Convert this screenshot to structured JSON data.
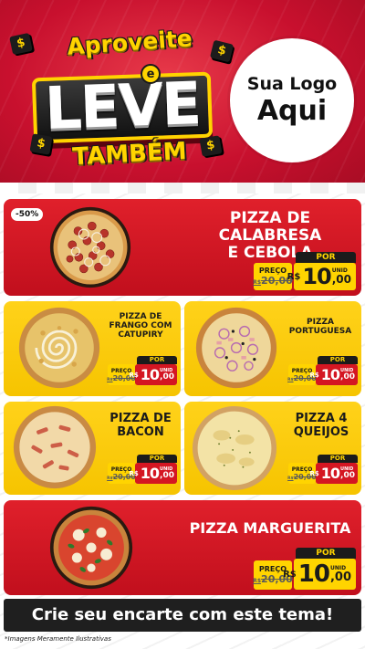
{
  "header": {
    "promo_line1": "Aproveite",
    "promo_connector": "e",
    "promo_line2": "LEVE",
    "promo_line3": "TAMBÉM",
    "logo_line1": "Sua Logo",
    "logo_line2": "Aqui"
  },
  "featured": {
    "discount": "-50%",
    "name_line1": "PIZZA DE CALABRESA",
    "name_line2": "E CEBOLA",
    "por_label": "POR",
    "preco_label": "PREÇO",
    "old_price_prefix": "R$",
    "old_price": "20,00",
    "currency": "R$",
    "price_int": "10",
    "price_dec": ",00",
    "unit": "UNID"
  },
  "grid": [
    {
      "name_lines": [
        "PIZZA DE",
        "FRANGO COM",
        "CATUPIRY"
      ],
      "por_label": "POR",
      "preco_label": "PREÇO",
      "old_price_prefix": "R$",
      "old_price": "20,00",
      "currency": "R$",
      "price_int": "10",
      "price_dec": ",00",
      "unit": "UNID"
    },
    {
      "name_lines": [
        "PIZZA",
        "PORTUGUESA"
      ],
      "por_label": "POR",
      "preco_label": "PREÇO",
      "old_price_prefix": "R$",
      "old_price": "20,00",
      "currency": "R$",
      "price_int": "10",
      "price_dec": ",00",
      "unit": "UNID"
    },
    {
      "name_lines": [
        "PIZZA DE",
        "BACON"
      ],
      "por_label": "POR",
      "preco_label": "PREÇO",
      "old_price_prefix": "R$",
      "old_price": "20,00",
      "currency": "R$",
      "price_int": "10",
      "price_dec": ",00",
      "unit": "UNID"
    },
    {
      "name_lines": [
        "PIZZA 4",
        "QUEIJOS"
      ],
      "por_label": "POR",
      "preco_label": "PREÇO",
      "old_price_prefix": "R$",
      "old_price": "20,00",
      "currency": "R$",
      "price_int": "10",
      "price_dec": ",00",
      "unit": "UNID"
    }
  ],
  "bottom": {
    "name": "PIZZA MARGUERITA",
    "por_label": "POR",
    "preco_label": "PREÇO",
    "old_price_prefix": "R$",
    "old_price": "20,00",
    "currency": "R$",
    "price_int": "10",
    "price_dec": ",00",
    "unit": "UNID"
  },
  "cta": "Crie seu encarte com este tema!",
  "disclaimer": "*Imagens Meramente Ilustrativas",
  "colors": {
    "brand_red": "#c8102e",
    "brand_yellow": "#ffd400",
    "dark": "#1b1b1b"
  },
  "icons": [
    "dollar-icon",
    "pizza-calabresa-image",
    "pizza-frango-image",
    "pizza-portuguesa-image",
    "pizza-bacon-image",
    "pizza-4-queijos-image",
    "pizza-marguerita-image"
  ]
}
